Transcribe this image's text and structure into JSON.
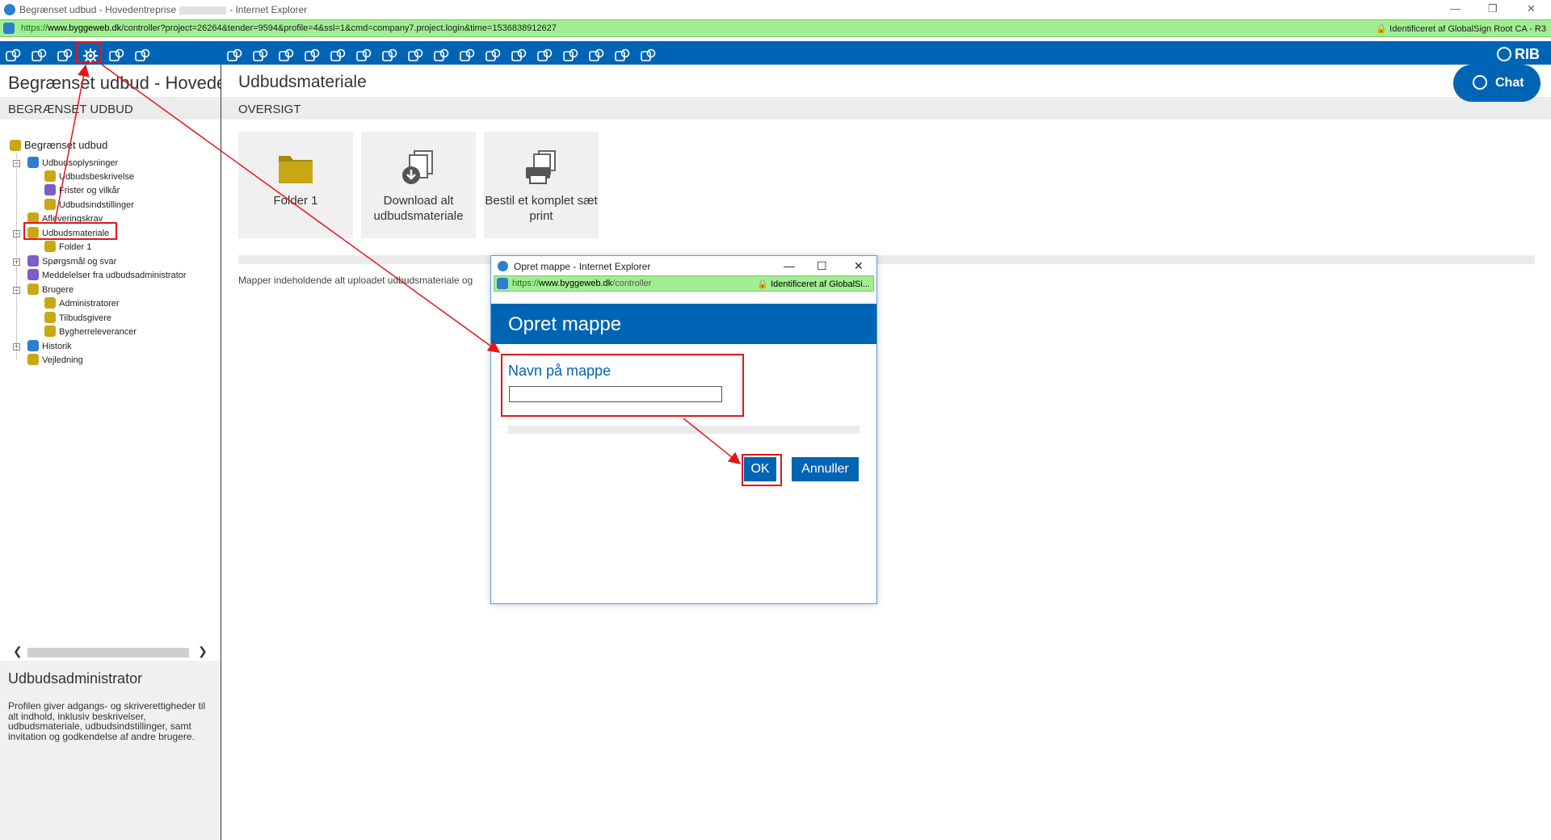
{
  "window": {
    "title_pre": "Begrænset udbud - Hovedentreprise",
    "title_post": "- Internet Explorer",
    "minimize": "—",
    "restore": "❐",
    "close": "✕"
  },
  "address": {
    "https": "https://",
    "host": "www.byggeweb.dk",
    "path": "/controller?project=26264&tender=9594&profile=4&ssl=1&cmd=company7.project.login&time=1536838912627",
    "cert": "🔒 Identificeret af GlobalSign Root CA - R3"
  },
  "toolbar": {
    "left_icons": [
      "tool-icon-1",
      "tool-icon-2",
      "tool-icon-3",
      "settings-gear-icon",
      "tool-icon-5",
      "tool-icon-6"
    ],
    "right_icon_count": 17,
    "brand": "RIB"
  },
  "left": {
    "title": "Begrænset udbud - Hovedentreprise",
    "section": "BEGRÆNSET UDBUD",
    "tree": [
      {
        "label": "Begrænset udbud",
        "level": 0
      },
      {
        "label": "Udbudsoplysninger",
        "level": 1
      },
      {
        "label": "Udbudsbeskrivelse",
        "level": 2
      },
      {
        "label": "Frister og vilkår",
        "level": 2
      },
      {
        "label": "Udbudsindstillinger",
        "level": 2
      },
      {
        "label": "Afleveringskrav",
        "level": 1
      },
      {
        "label": "Udbudsmateriale",
        "level": 1
      },
      {
        "label": "Folder 1",
        "level": 2
      },
      {
        "label": "Spørgsmål og svar",
        "level": 1
      },
      {
        "label": "Meddelelser fra udbudsadministrator",
        "level": 1
      },
      {
        "label": "Brugere",
        "level": 1
      },
      {
        "label": "Administratorer",
        "level": 2
      },
      {
        "label": "Tilbudsgivere",
        "level": 2
      },
      {
        "label": "Bygherreleverancer",
        "level": 2
      },
      {
        "label": "Historik",
        "level": 1
      },
      {
        "label": "Vejledning",
        "level": 1
      }
    ],
    "role_title": "Udbudsadministrator",
    "role_desc": "Profilen giver adgangs- og skriverettigheder til alt indhold, inklusiv beskrivelser, udbudsmateriale, udbudsindstillinger, samt invitation og godkendelse af andre brugere."
  },
  "main": {
    "title": "Udbudsmateriale",
    "section": "OVERSIGT",
    "tiles": [
      "Folder 1",
      "Download alt udbudsmateriale",
      "Bestil et komplet sæt print"
    ],
    "desc": "Mapper indeholdende alt uploadet udbudsmateriale og"
  },
  "chat": {
    "label": "Chat"
  },
  "dialog": {
    "window_title": "Opret mappe - Internet Explorer",
    "url_https": "https://",
    "url_host": "www.byggeweb.dk",
    "url_path": "/controller",
    "cert": "🔒 Identificeret af GlobalSi...",
    "header": "Opret mappe",
    "label": "Navn på mappe",
    "input_value": "",
    "ok": "OK",
    "cancel": "Annuller"
  },
  "colors": {
    "brand_blue": "#0064b4",
    "address_green": "#a2ee93",
    "annotation_red": "#e5151a"
  }
}
